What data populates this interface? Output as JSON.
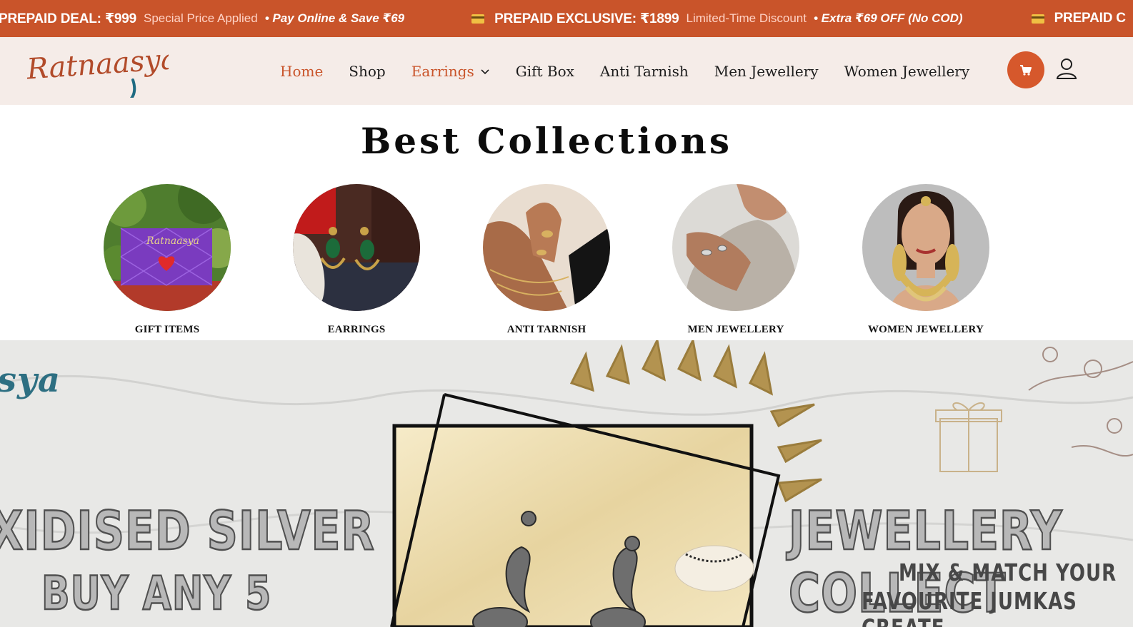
{
  "ticker": {
    "promos": [
      {
        "strong": "PREPAID DEAL: ₹999",
        "sub": "Special Price Applied",
        "dot": "•",
        "italic": "Pay Online & Save ₹69",
        "icon": "card-icon"
      },
      {
        "strong": "PREPAID EXCLUSIVE: ₹1899",
        "sub": "Limited-Time Discount",
        "dot": "•",
        "italic": "Extra ₹69 OFF (No COD)",
        "icon": "card-icon"
      },
      {
        "strong": "PREPAID C",
        "icon": "card-icon"
      }
    ],
    "colors": {
      "bg": "#c9542a"
    }
  },
  "header": {
    "logo_text": "Ratnaasya",
    "nav": [
      {
        "label": "Home",
        "state": "active"
      },
      {
        "label": "Shop"
      },
      {
        "label": "Earrings",
        "has_dropdown": true,
        "icon": "chevron-down-icon"
      },
      {
        "label": "Gift Box"
      },
      {
        "label": "Anti Tarnish"
      },
      {
        "label": "Men Jewellery"
      },
      {
        "label": "Women Jewellery"
      }
    ],
    "icons": {
      "cart": "cart-icon",
      "user": "user-icon"
    },
    "colors": {
      "accent": "#c9542a",
      "bg": "#f5ece8"
    }
  },
  "collections": {
    "title": "Best Collections",
    "items": [
      {
        "label": "GIFT ITEMS",
        "image": "gift-box-photo"
      },
      {
        "label": "EARRINGS",
        "image": "earrings-photo"
      },
      {
        "label": "ANTI TARNISH",
        "image": "rings-hand-photo"
      },
      {
        "label": "MEN JEWELLERY",
        "image": "men-ring-photo"
      },
      {
        "label": "WOMEN JEWELLERY",
        "image": "bridal-woman-photo"
      }
    ]
  },
  "hero": {
    "brand_fragment": "sya",
    "headline_left": "XIDISED SILVER",
    "headline_right": "JEWELLERY COLLECT",
    "sub_left": "BUY ANY 5",
    "sub_right_line1": "MIX & MATCH YOUR",
    "sub_right_line2": "FAVOURITE JUMKAS CREATE"
  }
}
